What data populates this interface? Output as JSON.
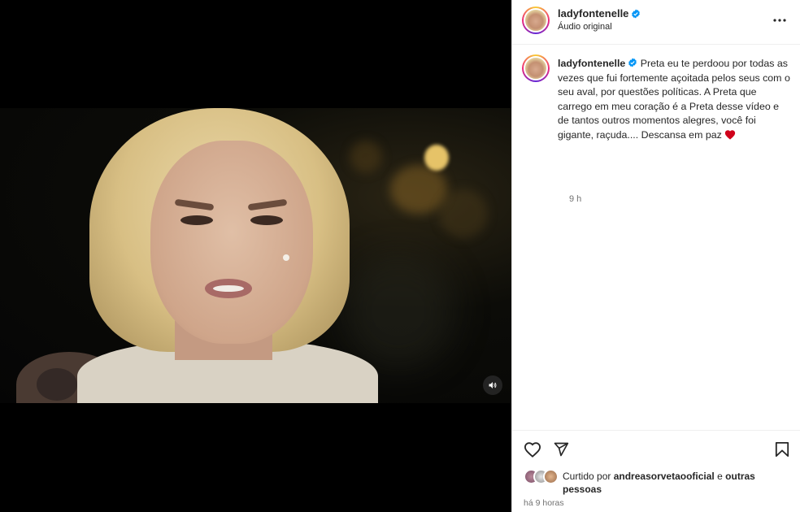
{
  "post": {
    "username": "ladyfontenelle",
    "audio": "Áudio original",
    "caption": "Preta eu te perdoou por todas as vezes que fui fortemente açoitada pelos seus com o seu aval, por questões políticas. A Preta que carrego em meu coração é a Preta desse vídeo e de tantos outros momentos alegres, você foi gigante, raçuda.... Descansa em paz",
    "caption_time": "9 h",
    "liked_prefix": "Curtido por",
    "liked_user": "andreasorvetaooficial",
    "liked_conj": "e",
    "liked_others": "outras pessoas",
    "posted_ago": "há 9 horas"
  },
  "icons": {
    "verified": "verified-badge-icon",
    "more": "more-options-icon",
    "like": "heart-icon",
    "share": "share-icon",
    "save": "bookmark-icon",
    "mute": "volume-icon",
    "emoji": "red-heart-emoji"
  },
  "colors": {
    "verified": "#0095f6",
    "text": "#262626",
    "muted": "#737373",
    "emoji_heart": "#d0021b"
  }
}
